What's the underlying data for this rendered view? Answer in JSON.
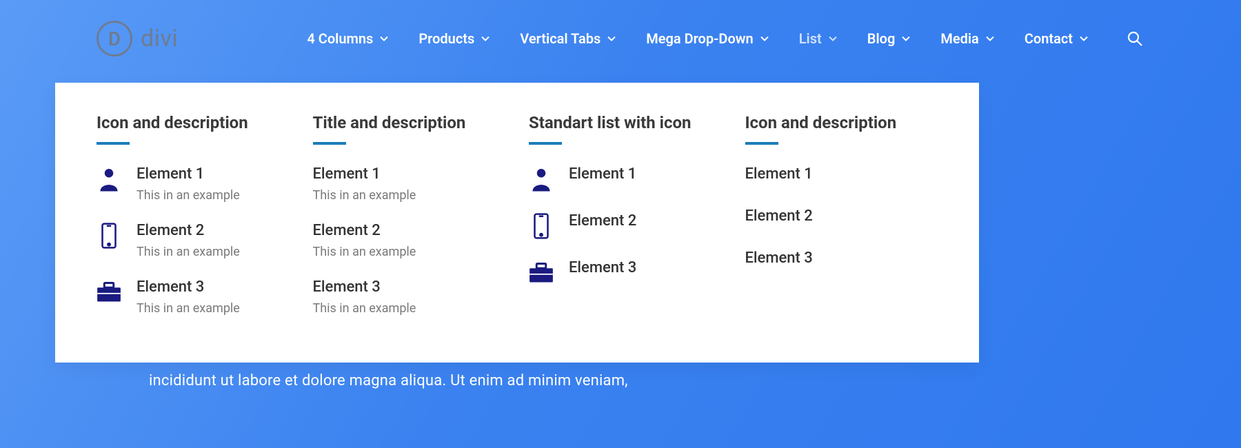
{
  "logo": {
    "letter": "D",
    "text": "divi"
  },
  "nav": [
    {
      "label": "4 Columns"
    },
    {
      "label": "Products"
    },
    {
      "label": "Vertical Tabs"
    },
    {
      "label": "Mega Drop-Down"
    },
    {
      "label": "List",
      "active": true
    },
    {
      "label": "Blog"
    },
    {
      "label": "Media"
    },
    {
      "label": "Contact"
    }
  ],
  "mega": {
    "columns": [
      {
        "title": "Icon and description",
        "type": "icon-desc",
        "items": [
          {
            "icon": "user",
            "title": "Element 1",
            "desc": "This in an example"
          },
          {
            "icon": "phone",
            "title": "Element 2",
            "desc": "This in an example"
          },
          {
            "icon": "briefcase",
            "title": "Element 3",
            "desc": "This in an example"
          }
        ]
      },
      {
        "title": "Title and description",
        "type": "title-desc",
        "items": [
          {
            "title": "Element 1",
            "desc": "This in an example"
          },
          {
            "title": "Element 2",
            "desc": "This in an example"
          },
          {
            "title": "Element 3",
            "desc": "This in an example"
          }
        ]
      },
      {
        "title": "Standart list with icon",
        "type": "icon-only",
        "items": [
          {
            "icon": "user",
            "title": "Element 1"
          },
          {
            "icon": "phone",
            "title": "Element 2"
          },
          {
            "icon": "briefcase",
            "title": "Element 3"
          }
        ]
      },
      {
        "title": "Icon and description",
        "type": "simple",
        "items": [
          {
            "title": "Element 1"
          },
          {
            "title": "Element 2"
          },
          {
            "title": "Element 3"
          }
        ]
      }
    ]
  },
  "body_text": "incididunt ut labore et dolore magna aliqua. Ut enim ad minim veniam,"
}
